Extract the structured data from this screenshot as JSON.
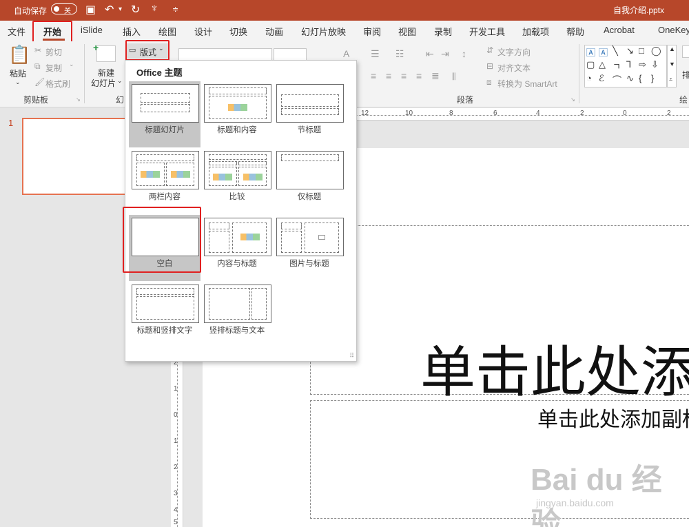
{
  "titlebar": {
    "autosave_label": "自动保存",
    "autosave_state": "关",
    "doc_title": "自我介绍.pptx"
  },
  "tabs": [
    "文件",
    "开始",
    "iSlide",
    "插入",
    "绘图",
    "设计",
    "切换",
    "动画",
    "幻灯片放映",
    "审阅",
    "视图",
    "录制",
    "开发工具",
    "加载项",
    "帮助",
    "Acrobat",
    "OneKey"
  ],
  "active_tab": "开始",
  "clipboard": {
    "paste": "粘贴",
    "cut": "剪切",
    "copy": "复制",
    "format_painter": "格式刷",
    "group_label": "剪贴板"
  },
  "slides": {
    "new_slide_line1": "新建",
    "new_slide_line2": "幻灯片",
    "layout_button": "版式",
    "group_label_partial": "幻"
  },
  "paragraph": {
    "text_direction": "文字方向",
    "align_text": "对齐文本",
    "convert_smartart": "转换为 SmartArt",
    "group_label": "段落"
  },
  "drawing": {
    "arrange_partial": "排",
    "group_label_partial": "绘"
  },
  "layout_menu": {
    "header": "Office 主题",
    "items": [
      "标题幻灯片",
      "标题和内容",
      "节标题",
      "两栏内容",
      "比较",
      "仅标题",
      "空白",
      "内容与标题",
      "图片与标题",
      "标题和竖排文字",
      "竖排标题与文本"
    ]
  },
  "thumbnail": {
    "number": "1"
  },
  "rulers": {
    "horizontal": [
      "12",
      "10",
      "8",
      "6",
      "4",
      "2",
      "0",
      "2"
    ],
    "vertical": [
      "2",
      "1",
      "0",
      "1",
      "2",
      "3",
      "4",
      "5"
    ]
  },
  "slide": {
    "title_placeholder": "单击此处添",
    "subtitle_placeholder": "单击此处添加副标"
  },
  "watermark": {
    "main": "Bai du 经验",
    "sub": "jingyan.baidu.com"
  },
  "colors": {
    "accent": "#b7472a",
    "highlight": "#e02020"
  }
}
